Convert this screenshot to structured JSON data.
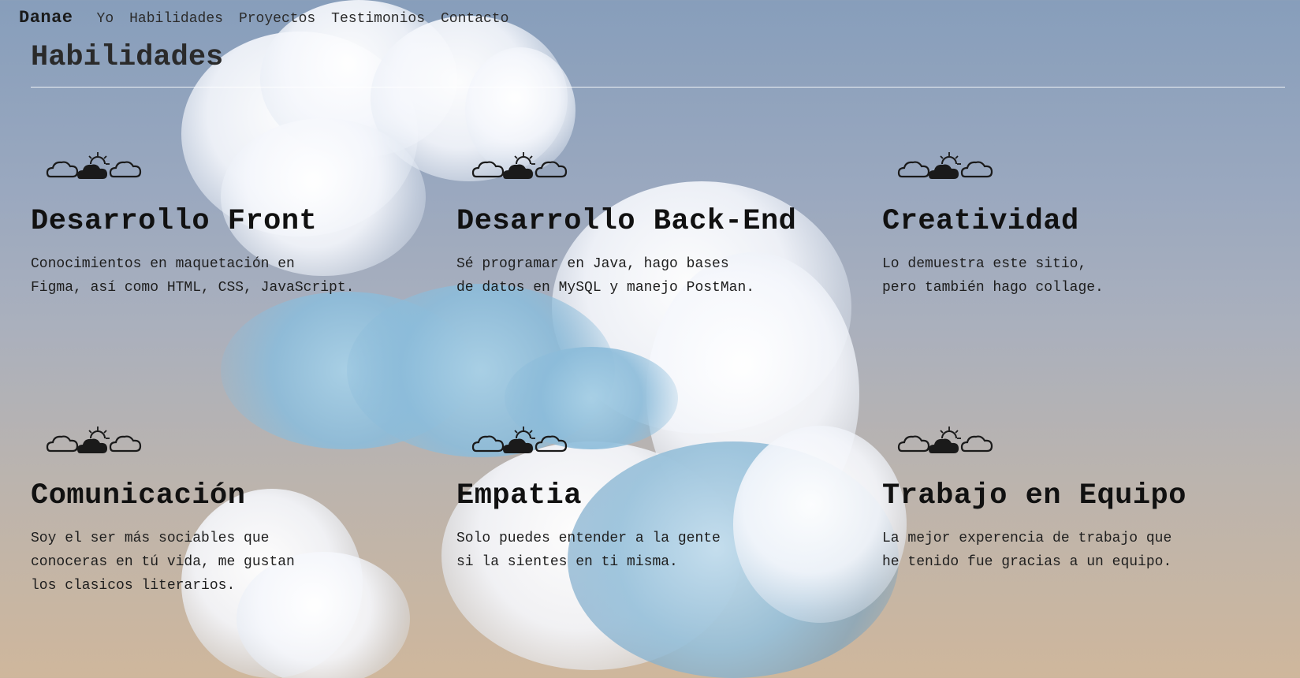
{
  "nav": {
    "brand": "Danae",
    "links": [
      "Yo",
      "Habilidades",
      "Proyectos",
      "Testimonios",
      "Contacto"
    ]
  },
  "section": {
    "title": "Habilidades"
  },
  "skills": [
    {
      "title": "Desarrollo Front",
      "description": "Conocimientos en maquetación en\nFigma, así como HTML, CSS, JavaScript."
    },
    {
      "title": "Desarrollo Back-End",
      "description": "Sé programar en Java, hago bases\nde datos en MySQL y manejo PostMan."
    },
    {
      "title": "Creatividad",
      "description": "Lo demuestra este sitio,\npero también hago collage."
    },
    {
      "title": "Comunicación",
      "description": "Soy el ser más sociables que\nconoceras en tú vida, me gustan\nlos clasicos literarios."
    },
    {
      "title": "Empatia",
      "description": "Solo puedes entender a la gente\nsi la sientes en ti misma."
    },
    {
      "title": "Trabajo en Equipo",
      "description": "La mejor experencia de trabajo que\nhe tenido fue gracias a un equipo."
    }
  ],
  "icons": {
    "skill_icon": "clouds-and-sun-icon"
  },
  "colors": {
    "gradient_top": "#879ebb",
    "gradient_bottom": "#cfb79c",
    "text": "#1a1a1a",
    "divider": "#ffffff"
  }
}
